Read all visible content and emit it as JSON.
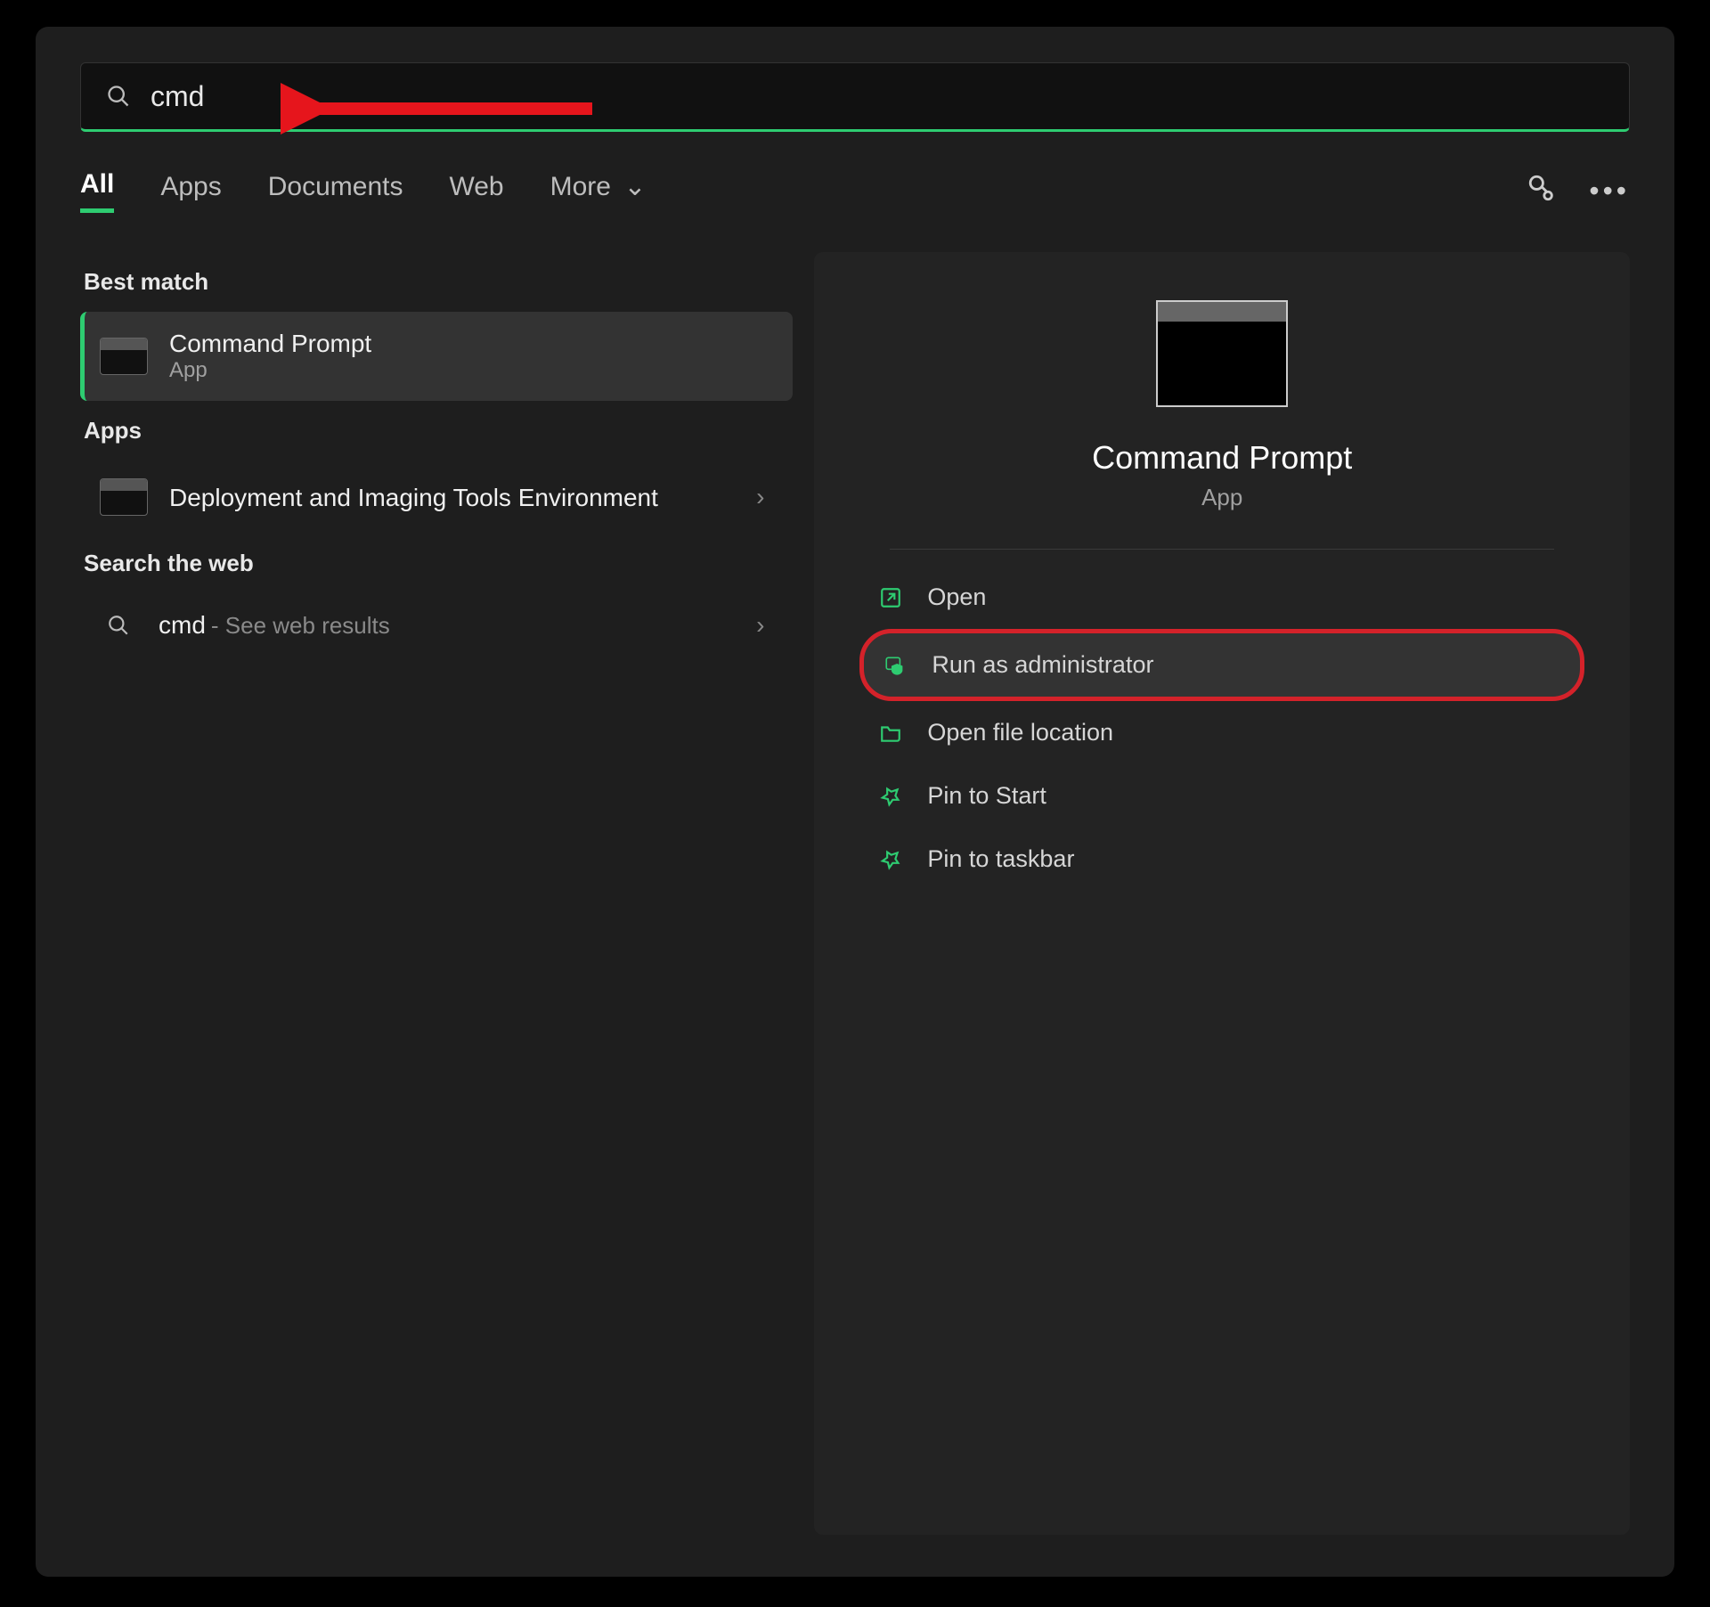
{
  "search": {
    "value": "cmd"
  },
  "tabs": {
    "all": "All",
    "apps": "Apps",
    "documents": "Documents",
    "web": "Web",
    "more": "More"
  },
  "sections": {
    "best_match": "Best match",
    "apps": "Apps",
    "search_web": "Search the web"
  },
  "best_match": {
    "title": "Command Prompt",
    "subtitle": "App"
  },
  "apps_results": {
    "item0": {
      "title": "Deployment and Imaging Tools Environment"
    }
  },
  "web_results": {
    "item0": {
      "query": "cmd",
      "suffix": " - See web results"
    }
  },
  "preview": {
    "title": "Command Prompt",
    "subtitle": "App"
  },
  "actions": {
    "open": "Open",
    "run_admin": "Run as administrator",
    "open_file_loc": "Open file location",
    "pin_start": "Pin to Start",
    "pin_taskbar": "Pin to taskbar"
  }
}
